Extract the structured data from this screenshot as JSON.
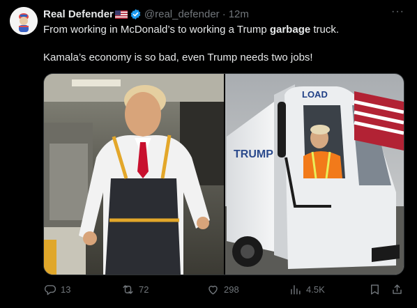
{
  "author": {
    "display_name": "Real Defender",
    "flag_icon": "us-flag-icon",
    "handle": "@real_defender",
    "separator": "·",
    "timestamp": "12m"
  },
  "tweet": {
    "line1_pre": "From working in McDonald’s to working a Trump ",
    "line1_bold": "garbage",
    "line1_post": " truck.",
    "line2": "Kamala’s economy is so bad, even Trump needs two jobs!"
  },
  "media": {
    "left_image": "man-in-apron-at-fast-food-kitchen",
    "right_image": "man-in-safety-vest-driving-garbage-truck",
    "truck_side_text": "TRUMP",
    "truck_top_text": "LOAD"
  },
  "actions": {
    "reply_count": "13",
    "retweet_count": "72",
    "like_count": "298",
    "views_count": "4.5K"
  },
  "colors": {
    "background": "#000000",
    "text": "#e7e9ea",
    "muted": "#71767b",
    "verified": "#1d9bf0"
  }
}
